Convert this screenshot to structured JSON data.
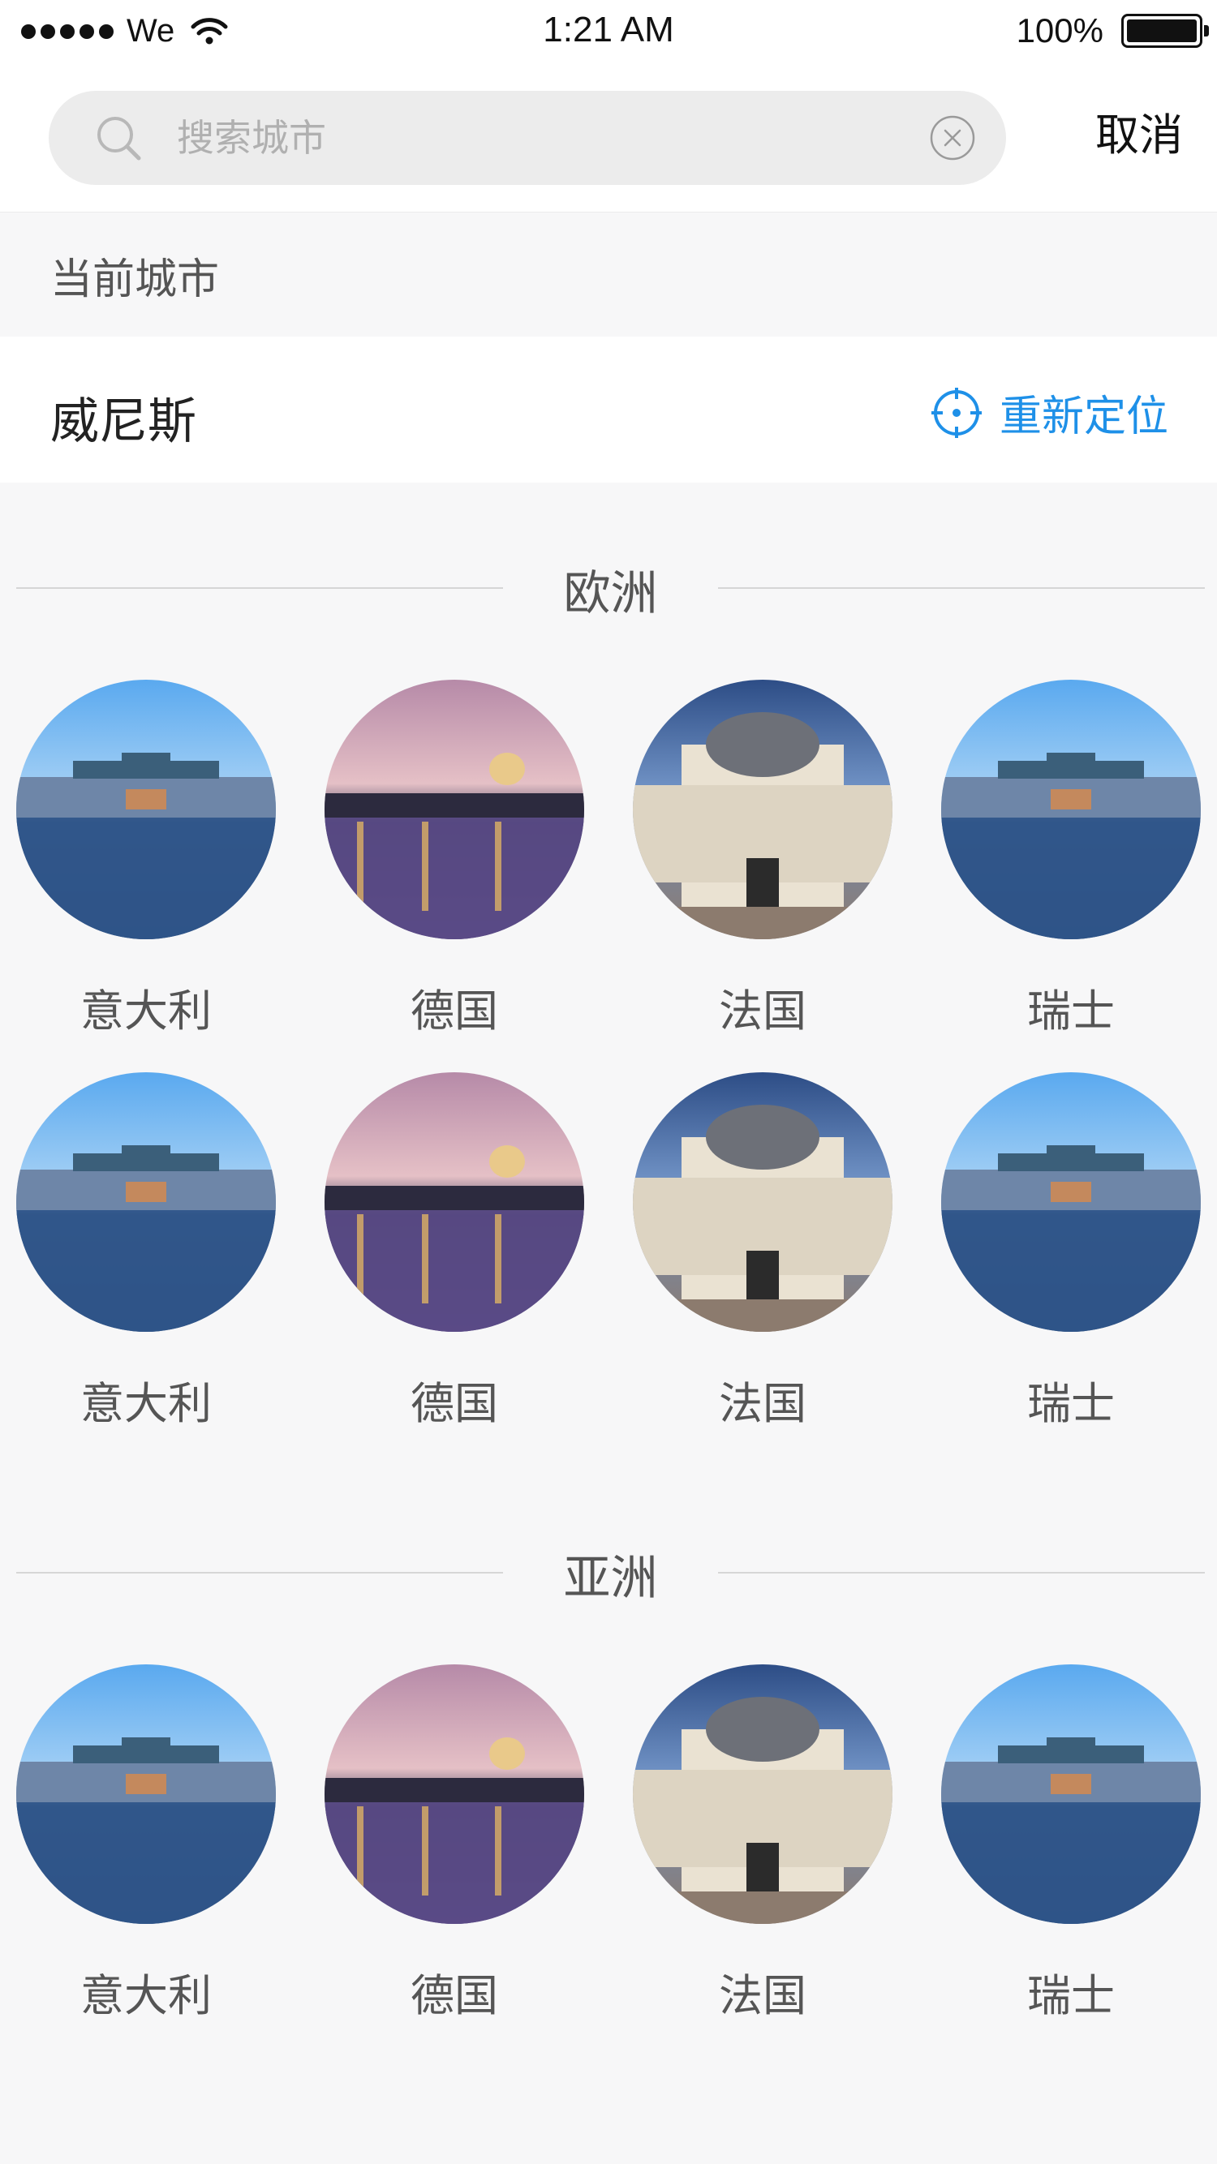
{
  "status_bar": {
    "carrier": "We",
    "time": "1:21 AM",
    "battery": "100%"
  },
  "search": {
    "placeholder": "搜索城市",
    "cancel_label": "取消"
  },
  "current": {
    "section_title": "当前城市",
    "city": "威尼斯",
    "relocate_label": "重新定位"
  },
  "colors": {
    "accent": "#1e90e8",
    "background": "#f7f7f8"
  },
  "regions": [
    {
      "title": "欧洲",
      "cities": [
        "意大利",
        "德国",
        "法国",
        "瑞士",
        "意大利",
        "德国",
        "法国",
        "瑞士"
      ]
    },
    {
      "title": "亚洲",
      "cities": [
        "意大利",
        "德国",
        "法国",
        "瑞士"
      ]
    }
  ]
}
